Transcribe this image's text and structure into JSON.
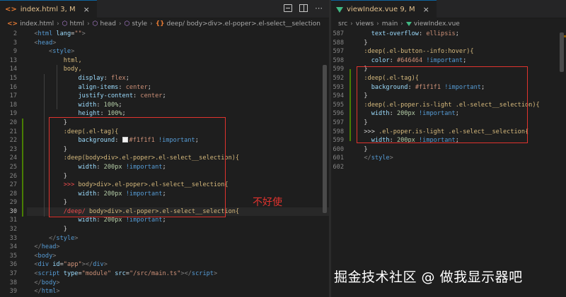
{
  "left_editor": {
    "tab": {
      "icon": "<>",
      "label": "index.html 3, M",
      "close": "×"
    },
    "breadcrumb": [
      "index.html",
      "html",
      "head",
      "style",
      "deep/ body>div>.el-poper>.el-select__selection"
    ],
    "line_numbers": [
      "2",
      "3",
      "9",
      "13",
      "14",
      "15",
      "16",
      "17",
      "18",
      "19",
      "20",
      "21",
      "22",
      "23",
      "24",
      "25",
      "26",
      "27",
      "28",
      "29",
      "30",
      "31",
      "32",
      "33",
      "34",
      "35",
      "36",
      "37",
      "38",
      "39"
    ],
    "lines": [
      [
        {
          "t": "  ",
          "c": "def"
        },
        {
          "t": "<",
          "c": "punc"
        },
        {
          "t": "html",
          "c": "tag"
        },
        {
          "t": " lang",
          "c": "attr"
        },
        {
          "t": "=",
          "c": "def"
        },
        {
          "t": "\"\"",
          "c": "str"
        },
        {
          "t": ">",
          "c": "punc"
        }
      ],
      [
        {
          "t": "  ",
          "c": "def"
        },
        {
          "t": "<",
          "c": "punc"
        },
        {
          "t": "head",
          "c": "tag"
        },
        {
          "t": ">",
          "c": "punc"
        }
      ],
      [
        {
          "t": "      ",
          "c": "def"
        },
        {
          "t": "<",
          "c": "punc"
        },
        {
          "t": "style",
          "c": "tag"
        },
        {
          "t": ">",
          "c": "punc"
        }
      ],
      [
        {
          "t": "          ",
          "c": "def"
        },
        {
          "t": "html,",
          "c": "sel"
        }
      ],
      [
        {
          "t": "          ",
          "c": "def"
        },
        {
          "t": "body,",
          "c": "sel"
        }
      ],
      [
        {
          "t": "              ",
          "c": "def"
        },
        {
          "t": "display",
          "c": "prop"
        },
        {
          "t": ": ",
          "c": "def"
        },
        {
          "t": "flex",
          "c": "val"
        },
        {
          "t": ";",
          "c": "def"
        }
      ],
      [
        {
          "t": "              ",
          "c": "def"
        },
        {
          "t": "align-items",
          "c": "prop"
        },
        {
          "t": ": ",
          "c": "def"
        },
        {
          "t": "center",
          "c": "val"
        },
        {
          "t": ";",
          "c": "def"
        }
      ],
      [
        {
          "t": "              ",
          "c": "def"
        },
        {
          "t": "justify-content",
          "c": "prop"
        },
        {
          "t": ": ",
          "c": "def"
        },
        {
          "t": "center",
          "c": "val"
        },
        {
          "t": ";",
          "c": "def"
        }
      ],
      [
        {
          "t": "              ",
          "c": "def"
        },
        {
          "t": "width",
          "c": "prop"
        },
        {
          "t": ": ",
          "c": "def"
        },
        {
          "t": "100%",
          "c": "num"
        },
        {
          "t": ";",
          "c": "def"
        }
      ],
      [
        {
          "t": "              ",
          "c": "def"
        },
        {
          "t": "height",
          "c": "prop"
        },
        {
          "t": ": ",
          "c": "def"
        },
        {
          "t": "100%",
          "c": "num"
        },
        {
          "t": ";",
          "c": "def"
        }
      ],
      [
        {
          "t": "          ",
          "c": "def"
        },
        {
          "t": "}",
          "c": "brace"
        }
      ],
      [
        {
          "t": "          ",
          "c": "def"
        },
        {
          "t": ":deep(.el-tag){",
          "c": "sel"
        }
      ],
      [
        {
          "t": "              ",
          "c": "def"
        },
        {
          "t": "background",
          "c": "prop"
        },
        {
          "t": ": ",
          "c": "def"
        },
        {
          "t": "SWATCH",
          "c": "swatch"
        },
        {
          "t": "#f1f1f1",
          "c": "val"
        },
        {
          "t": " !important",
          "c": "imp"
        },
        {
          "t": ";",
          "c": "def"
        }
      ],
      [
        {
          "t": "          ",
          "c": "def"
        },
        {
          "t": "}",
          "c": "brace"
        }
      ],
      [
        {
          "t": "          ",
          "c": "def"
        },
        {
          "t": ":deep(body>div>.el-poper>.el-select__selection){",
          "c": "sel"
        }
      ],
      [
        {
          "t": "              ",
          "c": "def"
        },
        {
          "t": "width",
          "c": "prop"
        },
        {
          "t": ": ",
          "c": "def"
        },
        {
          "t": "200px",
          "c": "num"
        },
        {
          "t": " !important",
          "c": "imp"
        },
        {
          "t": ";",
          "c": "def"
        }
      ],
      [
        {
          "t": "          ",
          "c": "def"
        },
        {
          "t": "}",
          "c": "brace"
        }
      ],
      [
        {
          "t": "          ",
          "c": "def"
        },
        {
          "t": ">>>",
          "c": "red"
        },
        {
          "t": " body>div>.el-poper>.el-select__selection{",
          "c": "sel"
        }
      ],
      [
        {
          "t": "              ",
          "c": "def"
        },
        {
          "t": "width",
          "c": "prop"
        },
        {
          "t": ": ",
          "c": "def"
        },
        {
          "t": "200px",
          "c": "num"
        },
        {
          "t": " !important",
          "c": "imp"
        },
        {
          "t": ";",
          "c": "def"
        }
      ],
      [
        {
          "t": "          ",
          "c": "def"
        },
        {
          "t": "}",
          "c": "brace"
        }
      ],
      [
        {
          "t": "          ",
          "c": "def"
        },
        {
          "t": "/deep/",
          "c": "red"
        },
        {
          "t": " body>div>.el-poper>.el-select__selection{",
          "c": "sel"
        }
      ],
      [
        {
          "t": "              ",
          "c": "def"
        },
        {
          "t": "width",
          "c": "prop"
        },
        {
          "t": ": ",
          "c": "def"
        },
        {
          "t": "200px",
          "c": "num"
        },
        {
          "t": " !important",
          "c": "imp"
        },
        {
          "t": ";",
          "c": "def"
        }
      ],
      [
        {
          "t": "          ",
          "c": "def"
        },
        {
          "t": "}",
          "c": "brace"
        }
      ],
      [
        {
          "t": "      ",
          "c": "def"
        },
        {
          "t": "</",
          "c": "punc"
        },
        {
          "t": "style",
          "c": "tag"
        },
        {
          "t": ">",
          "c": "punc"
        }
      ],
      [
        {
          "t": "  ",
          "c": "def"
        },
        {
          "t": "</",
          "c": "punc"
        },
        {
          "t": "head",
          "c": "tag"
        },
        {
          "t": ">",
          "c": "punc"
        }
      ],
      [
        {
          "t": "  ",
          "c": "def"
        },
        {
          "t": "<",
          "c": "punc"
        },
        {
          "t": "body",
          "c": "tag"
        },
        {
          "t": ">",
          "c": "punc"
        }
      ],
      [
        {
          "t": "  ",
          "c": "def"
        },
        {
          "t": "<",
          "c": "punc"
        },
        {
          "t": "div",
          "c": "tag"
        },
        {
          "t": " id",
          "c": "attr"
        },
        {
          "t": "=",
          "c": "def"
        },
        {
          "t": "\"app\"",
          "c": "str"
        },
        {
          "t": "></",
          "c": "punc"
        },
        {
          "t": "div",
          "c": "tag"
        },
        {
          "t": ">",
          "c": "punc"
        }
      ],
      [
        {
          "t": "  ",
          "c": "def"
        },
        {
          "t": "<",
          "c": "punc"
        },
        {
          "t": "script",
          "c": "tag"
        },
        {
          "t": " type",
          "c": "attr"
        },
        {
          "t": "=",
          "c": "def"
        },
        {
          "t": "\"module\"",
          "c": "str"
        },
        {
          "t": " src",
          "c": "attr"
        },
        {
          "t": "=",
          "c": "def"
        },
        {
          "t": "\"/src/main.ts\"",
          "c": "str"
        },
        {
          "t": "></",
          "c": "punc"
        },
        {
          "t": "script",
          "c": "tag"
        },
        {
          "t": ">",
          "c": "punc"
        }
      ],
      [
        {
          "t": "  ",
          "c": "def"
        },
        {
          "t": "</",
          "c": "punc"
        },
        {
          "t": "body",
          "c": "tag"
        },
        {
          "t": ">",
          "c": "punc"
        }
      ],
      [
        {
          "t": "  ",
          "c": "def"
        },
        {
          "t": "</",
          "c": "punc"
        },
        {
          "t": "html",
          "c": "tag"
        },
        {
          "t": ">",
          "c": "punc"
        }
      ]
    ],
    "annotation": "不好使"
  },
  "right_editor": {
    "tab": {
      "label": "viewIndex.vue 9, M",
      "close": "×"
    },
    "breadcrumb": [
      "src",
      "views",
      "main",
      "viewIndex.vue"
    ],
    "line_numbers": [
      "587",
      "588",
      "597",
      "598",
      "599",
      "592",
      "593",
      "594",
      "595",
      "596",
      "597",
      "598",
      "599",
      "600",
      "601",
      "602"
    ],
    "lines": [
      [
        {
          "t": "    ",
          "c": "def"
        },
        {
          "t": "text-overflow",
          "c": "prop"
        },
        {
          "t": ": ",
          "c": "def"
        },
        {
          "t": "ellipsis",
          "c": "val"
        },
        {
          "t": ";",
          "c": "def"
        }
      ],
      [
        {
          "t": "  ",
          "c": "def"
        },
        {
          "t": "}",
          "c": "brace"
        }
      ],
      [
        {
          "t": "  ",
          "c": "def"
        },
        {
          "t": ":deep(.el-button--info:hover){",
          "c": "sel"
        }
      ],
      [
        {
          "t": "    ",
          "c": "def"
        },
        {
          "t": "color",
          "c": "prop"
        },
        {
          "t": ": ",
          "c": "def"
        },
        {
          "t": "#646464",
          "c": "val"
        },
        {
          "t": " !important",
          "c": "imp"
        },
        {
          "t": ";",
          "c": "def"
        }
      ],
      [
        {
          "t": "  ",
          "c": "def"
        },
        {
          "t": "}",
          "c": "brace"
        }
      ],
      [
        {
          "t": "  ",
          "c": "def"
        },
        {
          "t": ":deep(.el-tag){",
          "c": "sel"
        }
      ],
      [
        {
          "t": "    ",
          "c": "def"
        },
        {
          "t": "background",
          "c": "prop"
        },
        {
          "t": ": ",
          "c": "def"
        },
        {
          "t": "#f1f1f1",
          "c": "val"
        },
        {
          "t": " !important",
          "c": "imp"
        },
        {
          "t": ";",
          "c": "def"
        }
      ],
      [
        {
          "t": "  ",
          "c": "def"
        },
        {
          "t": "}",
          "c": "brace"
        }
      ],
      [
        {
          "t": "  ",
          "c": "def"
        },
        {
          "t": ":deep(.el-poper.is-light .el-select__selection){",
          "c": "sel"
        }
      ],
      [
        {
          "t": "    ",
          "c": "def"
        },
        {
          "t": "width",
          "c": "prop"
        },
        {
          "t": ": ",
          "c": "def"
        },
        {
          "t": "200px",
          "c": "num"
        },
        {
          "t": " !important",
          "c": "imp"
        },
        {
          "t": ";",
          "c": "def"
        }
      ],
      [
        {
          "t": "  ",
          "c": "def"
        },
        {
          "t": "}",
          "c": "brace"
        }
      ],
      [
        {
          "t": "  ",
          "c": "def"
        },
        {
          "t": ">>>",
          "c": "comb"
        },
        {
          "t": " .el-poper.is-light .el-select__selection{",
          "c": "sel"
        }
      ],
      [
        {
          "t": "    ",
          "c": "def"
        },
        {
          "t": "width",
          "c": "prop"
        },
        {
          "t": ": ",
          "c": "def"
        },
        {
          "t": "200px",
          "c": "num"
        },
        {
          "t": " !important",
          "c": "imp"
        },
        {
          "t": ";",
          "c": "def"
        }
      ],
      [
        {
          "t": "  ",
          "c": "def"
        },
        {
          "t": "}",
          "c": "brace"
        }
      ],
      [
        {
          "t": "  ",
          "c": "def"
        },
        {
          "t": "</",
          "c": "punc"
        },
        {
          "t": "style",
          "c": "tag"
        },
        {
          "t": ">",
          "c": "punc"
        }
      ],
      [
        {
          "t": "",
          "c": "def"
        }
      ]
    ]
  },
  "watermark": "掘金技术社区 @ 做我显示器吧",
  "colors": {
    "accent_red": "#e0332e",
    "modified_gutter": "#487e02",
    "tab_modified": "#e2c08d"
  }
}
